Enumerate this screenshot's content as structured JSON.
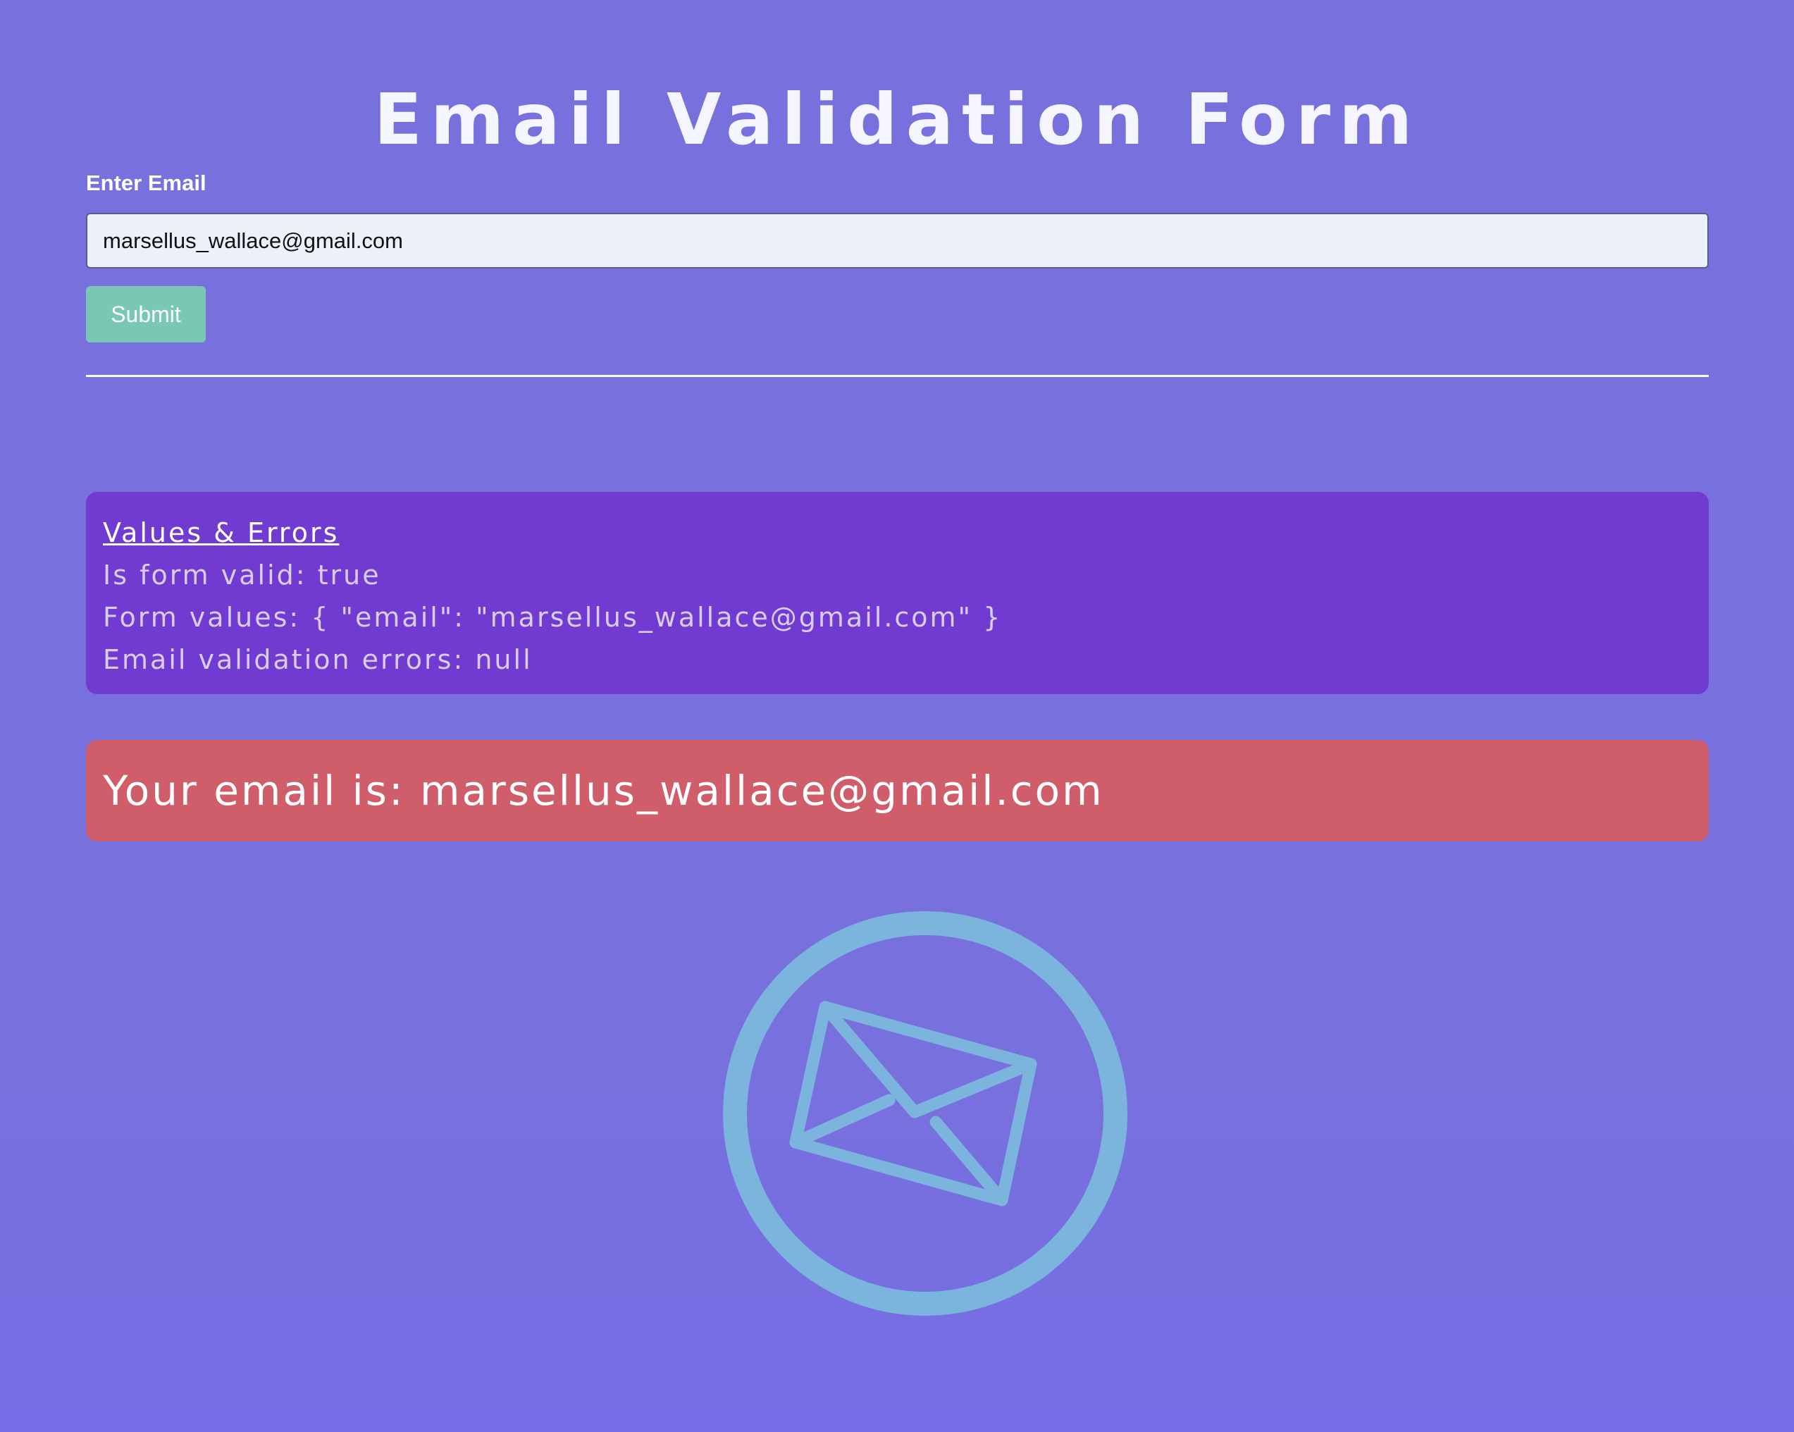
{
  "form": {
    "title": "Email Validation Form",
    "email_label": "Enter Email",
    "email_value": "marsellus_wallace@gmail.com",
    "submit_label": "Submit"
  },
  "debug_panel": {
    "heading": "Values & Errors",
    "form_valid": "Is form valid: true",
    "form_values": "Form values: { \"email\": \"marsellus_wallace@gmail.com\" }",
    "email_errors": "Email validation errors: null"
  },
  "result": {
    "text": "Your email is: marsellus_wallace@gmail.com"
  },
  "icons": {
    "mail": "envelope-circle-icon"
  },
  "colors": {
    "background": "#7770dd",
    "input_background": "#ebf0fb",
    "submit_button": "#79c8b4",
    "values_panel": "#713bd2",
    "result_panel": "#d05d6a",
    "icon_stroke": "#7bb4dc"
  }
}
